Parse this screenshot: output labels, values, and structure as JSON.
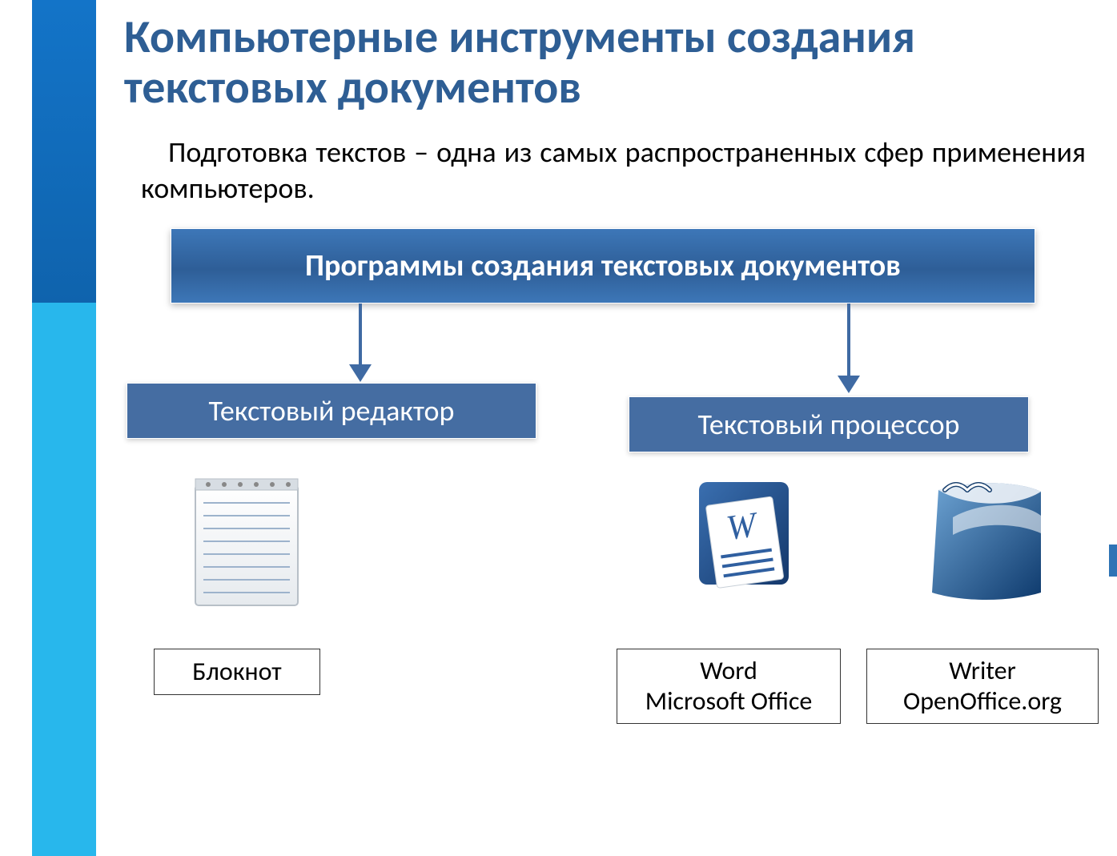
{
  "title": "Компьютерные инструменты создания текстовых документов",
  "subtitle": "Подготовка текстов – одна из самых распространенных сфер применения компьютеров.",
  "root": "Программы создания текстовых документов",
  "branches": {
    "left": "Текстовый редактор",
    "right": "Текстовый процессор"
  },
  "apps": {
    "notepad": "Блокнот",
    "word_line1": "Word",
    "word_line2": "Microsoft Office",
    "writer_line1": "Writer",
    "writer_line2": "OpenOffice.org"
  }
}
